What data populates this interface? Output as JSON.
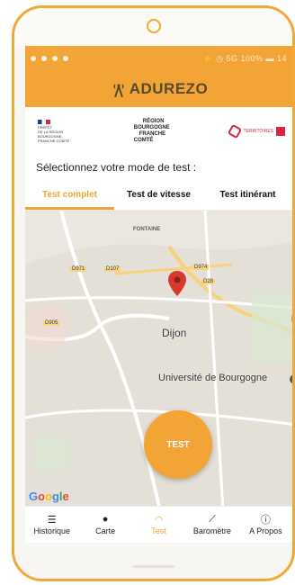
{
  "app": {
    "name": "ADUREZO"
  },
  "statusbar": {
    "right_text": "⚡ ◷ 5G 100% ▬ 14"
  },
  "partners": {
    "prefet": [
      "PRÉFET",
      "DE LA RÉGION",
      "BOURGOGNE-",
      "FRANCHE-COMTÉ"
    ],
    "region": [
      "RÉGION",
      "BOURGOGNE",
      "FRANCHE",
      "COMTÉ"
    ],
    "territoires": "TERRITOIRES"
  },
  "select_title": "Sélectionnez votre mode de test :",
  "tabs": [
    {
      "label": "Test complet",
      "active": true
    },
    {
      "label": "Test de vitesse",
      "active": false
    },
    {
      "label": "Test itinérant",
      "active": false
    }
  ],
  "map": {
    "city_label": "Dijon",
    "university_label": "Université de Bourgogne",
    "fontaine_label": "FONTAINE",
    "roads": [
      "D971",
      "D107",
      "D974",
      "D28",
      "D905"
    ],
    "google": "Google",
    "test_button": "TEST"
  },
  "bottom_nav": [
    {
      "label": "Historique",
      "icon": "list-icon"
    },
    {
      "label": "Carte",
      "icon": "location-icon"
    },
    {
      "label": "Test",
      "icon": "speed-icon",
      "active": true
    },
    {
      "label": "Baromètre",
      "icon": "chart-icon"
    },
    {
      "label": "A Propos",
      "icon": "info-icon"
    }
  ],
  "colors": {
    "accent": "#f2a436",
    "pin": "#d63a2f"
  }
}
